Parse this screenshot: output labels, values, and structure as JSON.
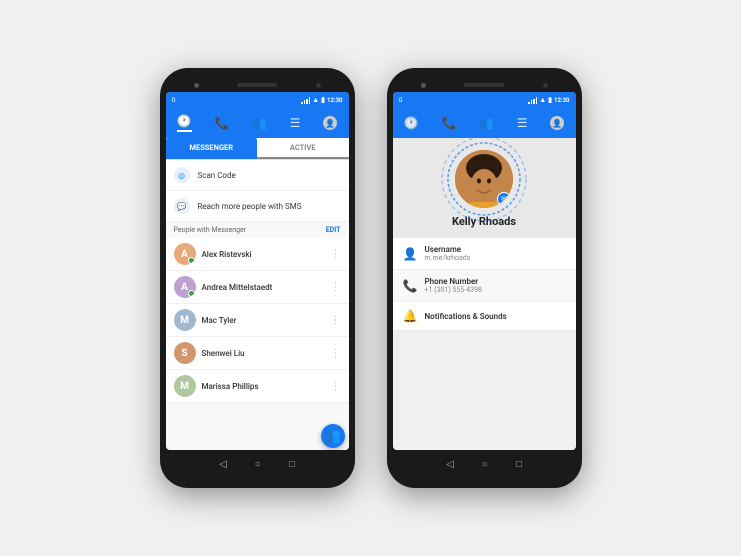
{
  "app": {
    "name": "Messenger"
  },
  "phone_left": {
    "status_bar": {
      "time": "12:30",
      "google_label": "G"
    },
    "nav_icons": [
      "🕐",
      "📞",
      "👥",
      "☰",
      "👤"
    ],
    "tabs": [
      {
        "label": "MESSENGER",
        "active": true
      },
      {
        "label": "ACTIVE",
        "active": false
      }
    ],
    "menu_items": [
      {
        "icon": "◎",
        "label": "Scan Code"
      },
      {
        "icon": "💬",
        "label": "Reach more people with SMS"
      }
    ],
    "section": {
      "label": "People with Messenger",
      "edit": "EDIT"
    },
    "contacts": [
      {
        "name": "Alex Ristevski",
        "initials": "A",
        "color": "#e8a87c",
        "online": true
      },
      {
        "name": "Andrea Mittelstaedt",
        "initials": "A",
        "color": "#c0a0d0",
        "online": true
      },
      {
        "name": "Mac Tyler",
        "initials": "M",
        "color": "#a0b8d0",
        "online": false
      },
      {
        "name": "Shenwei Liu",
        "initials": "S",
        "color": "#d4956a",
        "online": false
      },
      {
        "name": "Marissa Phillips",
        "initials": "M",
        "color": "#b0c8a0",
        "online": false
      }
    ],
    "nav_buttons": [
      "◁",
      "○",
      "□"
    ]
  },
  "phone_right": {
    "status_bar": {
      "time": "12:30"
    },
    "profile": {
      "name": "Kelly Rhoads"
    },
    "rows": [
      {
        "icon": "👤",
        "label": "Username",
        "value": "m.me/krhoads"
      },
      {
        "icon": "📞",
        "label": "Phone Number",
        "value": "+1 (301) 555-4398"
      },
      {
        "icon": "🔔",
        "label": "Notifications & Sounds",
        "value": ""
      }
    ],
    "nav_buttons": [
      "◁",
      "○",
      "□"
    ]
  }
}
